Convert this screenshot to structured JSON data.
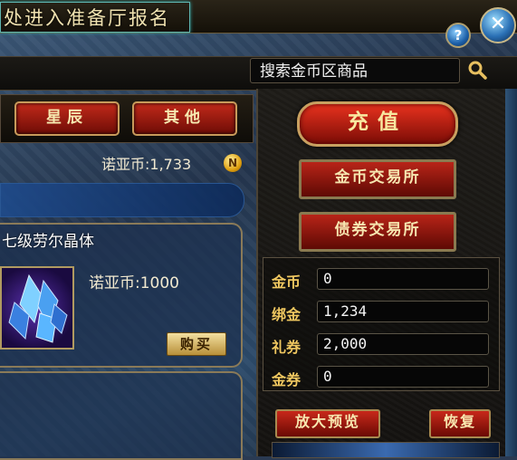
{
  "window": {
    "title": "处进入准备厅报名"
  },
  "header": {
    "help_label": "?",
    "close_label": "✕"
  },
  "search": {
    "text": "搜索金币区商品"
  },
  "tabs": [
    {
      "label": "星辰"
    },
    {
      "label": "其他"
    }
  ],
  "balance": {
    "label": "诺亚币:1,733",
    "coin_symbol": "N"
  },
  "item": {
    "name": "七级劳尔晶体",
    "price_label": "诺亚币:1000",
    "buy_label": "购买"
  },
  "actions": {
    "recharge_label": "充值",
    "gold_exchange_label": "金币交易所",
    "bond_exchange_label": "债券交易所"
  },
  "wallet": [
    {
      "label": "金币",
      "value": "0"
    },
    {
      "label": "绑金",
      "value": "1,234"
    },
    {
      "label": "礼券",
      "value": "2,000"
    },
    {
      "label": "金券",
      "value": "0"
    }
  ],
  "footer": {
    "zoom_preview_label": "放大预览",
    "restore_label": "恢复"
  },
  "colors": {
    "accent_red": "#c22a1a",
    "gold_text": "#f0c860",
    "frame_gold": "#c8a060"
  }
}
